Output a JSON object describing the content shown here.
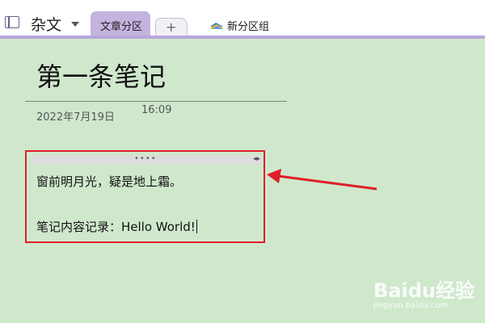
{
  "notebook": {
    "name": "杂文",
    "icon": "notebook-icon"
  },
  "tabs": [
    {
      "label": "文章分区",
      "active": true
    },
    {
      "label": "+",
      "active": false
    }
  ],
  "section_group": {
    "label": "新分区组",
    "icon": "section-group-icon"
  },
  "page": {
    "title": "第一条笔记",
    "date": "2022年7月19日",
    "time": "16:09"
  },
  "note": {
    "grip": "••••",
    "resize": "◂▸",
    "lines": [
      "窗前明月光，疑是地上霜。",
      "笔记内容记录：Hello World!"
    ]
  },
  "watermark": {
    "logo": "Baidu经验",
    "url": "jingyan.baidu.com"
  },
  "colors": {
    "accent": "#b8a6dc",
    "active_tab": "#c4b3df",
    "canvas": "#cfe8cc",
    "highlight": "#e01e2a"
  }
}
